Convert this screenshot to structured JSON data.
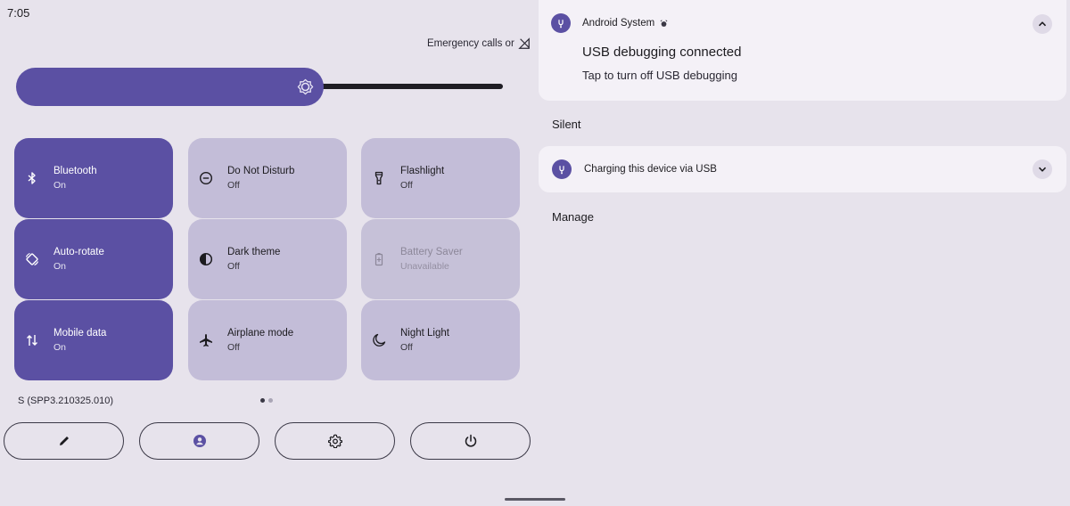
{
  "status_bar": {
    "time": "7:05"
  },
  "emergency": {
    "label": "Emergency calls or",
    "icon": "no-signal-icon"
  },
  "brightness": {
    "level_percent": 63,
    "icon": "brightness-icon",
    "accent": "#5b50a3"
  },
  "tiles": [
    {
      "name": "Bluetooth",
      "state": "On",
      "status": "on",
      "icon": "bluetooth-icon"
    },
    {
      "name": "Do Not Disturb",
      "state": "Off",
      "status": "off",
      "icon": "do-not-disturb-icon"
    },
    {
      "name": "Flashlight",
      "state": "Off",
      "status": "off",
      "icon": "flashlight-icon"
    },
    {
      "name": "Auto-rotate",
      "state": "On",
      "status": "on",
      "icon": "auto-rotate-icon"
    },
    {
      "name": "Dark theme",
      "state": "Off",
      "status": "off",
      "icon": "dark-theme-icon"
    },
    {
      "name": "Battery Saver",
      "state": "Unavailable",
      "status": "unavailable",
      "icon": "battery-saver-icon"
    },
    {
      "name": "Mobile data",
      "state": "On",
      "status": "on",
      "icon": "mobile-data-icon"
    },
    {
      "name": "Airplane mode",
      "state": "Off",
      "status": "off",
      "icon": "airplane-icon"
    },
    {
      "name": "Night Light",
      "state": "Off",
      "status": "off",
      "icon": "night-light-icon"
    }
  ],
  "build": "S (SPP3.210325.010)",
  "page_indicator": {
    "current": 1,
    "total": 2
  },
  "footer_buttons": [
    {
      "name": "edit-button",
      "icon": "pencil-icon"
    },
    {
      "name": "user-button",
      "icon": "user-icon"
    },
    {
      "name": "settings-button",
      "icon": "gear-icon"
    },
    {
      "name": "power-button",
      "icon": "power-icon"
    }
  ],
  "notifications": {
    "usb_debugging": {
      "app": "Android System",
      "title": "USB debugging connected",
      "text": "Tap to turn off USB debugging",
      "icon": "usb-icon",
      "chevron": "chevron-up-icon"
    },
    "silent_header": "Silent",
    "charging": {
      "text": "Charging this device via USB",
      "icon": "usb-icon",
      "chevron": "chevron-down-icon"
    },
    "manage_label": "Manage"
  }
}
